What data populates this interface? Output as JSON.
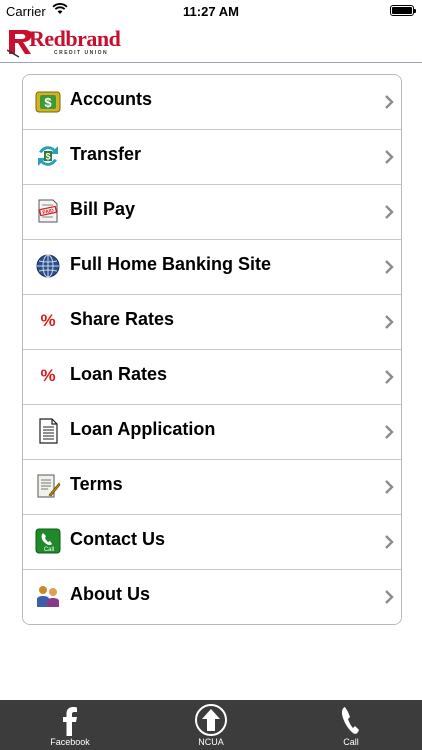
{
  "status_bar": {
    "carrier": "Carrier",
    "time": "11:27 AM"
  },
  "brand": {
    "name": "Redbrand",
    "subtitle": "CREDIT UNION",
    "accent_color": "#c8102e"
  },
  "menu": [
    {
      "label": "Accounts",
      "icon": "dollar-wallet-icon"
    },
    {
      "label": "Transfer",
      "icon": "transfer-icon"
    },
    {
      "label": "Bill Pay",
      "icon": "bill-paid-icon"
    },
    {
      "label": "Full Home Banking Site",
      "icon": "globe-icon"
    },
    {
      "label": "Share Rates",
      "icon": "percent-icon"
    },
    {
      "label": "Loan Rates",
      "icon": "percent-icon"
    },
    {
      "label": "Loan Application",
      "icon": "document-icon"
    },
    {
      "label": "Terms",
      "icon": "terms-document-icon"
    },
    {
      "label": "Contact Us",
      "icon": "phone-call-icon"
    },
    {
      "label": "About Us",
      "icon": "people-icon"
    }
  ],
  "tab_bar": {
    "background": "#3c3c3c",
    "tabs": [
      {
        "label": "Facebook",
        "icon": "facebook-icon"
      },
      {
        "label": "NCUA",
        "icon": "ncua-logo-icon"
      },
      {
        "label": "Call",
        "icon": "phone-icon"
      }
    ]
  }
}
